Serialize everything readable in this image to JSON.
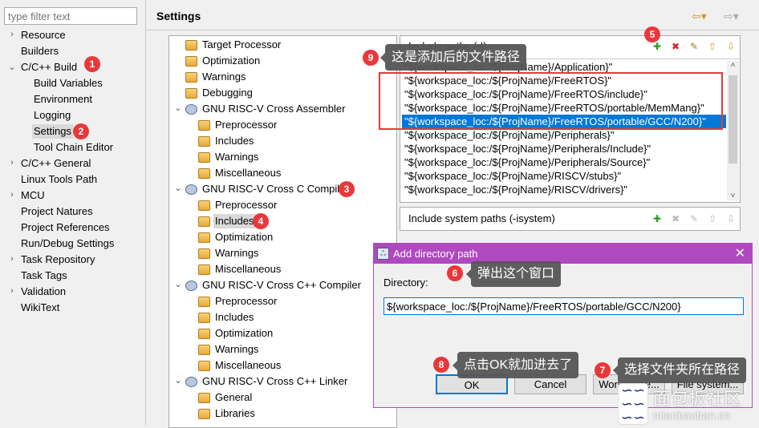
{
  "left": {
    "filter_placeholder": "type filter text",
    "items": [
      {
        "label": "Resource",
        "level": 0,
        "chevron": ">"
      },
      {
        "label": "Builders",
        "level": 0
      },
      {
        "label": "C/C++ Build",
        "level": 0,
        "chevron": "v"
      },
      {
        "label": "Build Variables",
        "level": 1
      },
      {
        "label": "Environment",
        "level": 1
      },
      {
        "label": "Logging",
        "level": 1
      },
      {
        "label": "Settings",
        "level": 1,
        "selected": true
      },
      {
        "label": "Tool Chain Editor",
        "level": 1
      },
      {
        "label": "C/C++ General",
        "level": 0,
        "chevron": ">"
      },
      {
        "label": "Linux Tools Path",
        "level": 0
      },
      {
        "label": "MCU",
        "level": 0,
        "chevron": ">"
      },
      {
        "label": "Project Natures",
        "level": 0
      },
      {
        "label": "Project References",
        "level": 0
      },
      {
        "label": "Run/Debug Settings",
        "level": 0
      },
      {
        "label": "Task Repository",
        "level": 0,
        "chevron": ">"
      },
      {
        "label": "Task Tags",
        "level": 0
      },
      {
        "label": "Validation",
        "level": 0,
        "chevron": ">"
      },
      {
        "label": "WikiText",
        "level": 0
      }
    ]
  },
  "header": {
    "title": "Settings",
    "back_icon": "back-arrow-icon",
    "forward_icon": "forward-arrow-icon"
  },
  "tool_tree": [
    {
      "label": "Target Processor",
      "level": 1,
      "icon": "folder"
    },
    {
      "label": "Optimization",
      "level": 1,
      "icon": "folder"
    },
    {
      "label": "Warnings",
      "level": 1,
      "icon": "folder"
    },
    {
      "label": "Debugging",
      "level": 1,
      "icon": "folder"
    },
    {
      "label": "GNU RISC-V Cross Assembler",
      "level": 0,
      "icon": "tool"
    },
    {
      "label": "Preprocessor",
      "level": 2,
      "icon": "folder"
    },
    {
      "label": "Includes",
      "level": 2,
      "icon": "folder"
    },
    {
      "label": "Warnings",
      "level": 2,
      "icon": "folder"
    },
    {
      "label": "Miscellaneous",
      "level": 2,
      "icon": "folder"
    },
    {
      "label": "GNU RISC-V Cross C Compiler",
      "level": 0,
      "icon": "tool"
    },
    {
      "label": "Preprocessor",
      "level": 2,
      "icon": "folder"
    },
    {
      "label": "Includes",
      "level": 2,
      "icon": "folder",
      "selected": true
    },
    {
      "label": "Optimization",
      "level": 2,
      "icon": "folder"
    },
    {
      "label": "Warnings",
      "level": 2,
      "icon": "folder"
    },
    {
      "label": "Miscellaneous",
      "level": 2,
      "icon": "folder"
    },
    {
      "label": "GNU RISC-V Cross C++ Compiler",
      "level": 0,
      "icon": "tool"
    },
    {
      "label": "Preprocessor",
      "level": 2,
      "icon": "folder"
    },
    {
      "label": "Includes",
      "level": 2,
      "icon": "folder"
    },
    {
      "label": "Optimization",
      "level": 2,
      "icon": "folder"
    },
    {
      "label": "Warnings",
      "level": 2,
      "icon": "folder"
    },
    {
      "label": "Miscellaneous",
      "level": 2,
      "icon": "folder"
    },
    {
      "label": "GNU RISC-V Cross C++ Linker",
      "level": 0,
      "icon": "tool"
    },
    {
      "label": "General",
      "level": 2,
      "icon": "folder"
    },
    {
      "label": "Libraries",
      "level": 2,
      "icon": "folder"
    }
  ],
  "include_paths": {
    "title": "Include paths (-I)",
    "toolbar": [
      "add-icon",
      "delete-icon",
      "edit-icon",
      "move-up-icon",
      "move-down-icon"
    ],
    "items": [
      "\"${workspace_loc:/${ProjName}/Application}\"",
      "\"${workspace_loc:/${ProjName}/FreeRTOS}\"",
      "\"${workspace_loc:/${ProjName}/FreeRTOS/include}\"",
      "\"${workspace_loc:/${ProjName}/FreeRTOS/portable/MemMang}\"",
      "\"${workspace_loc:/${ProjName}/FreeRTOS/portable/GCC/N200}\"",
      "\"${workspace_loc:/${ProjName}/Peripherals}\"",
      "\"${workspace_loc:/${ProjName}/Peripherals/Include}\"",
      "\"${workspace_loc:/${ProjName}/Peripherals/Source}\"",
      "\"${workspace_loc:/${ProjName}/RISCV/stubs}\"",
      "\"${workspace_loc:/${ProjName}/RISCV/drivers}\""
    ],
    "selected_index": 4
  },
  "system_paths": {
    "title": "Include system paths (-isystem)"
  },
  "dialog": {
    "title": "Add directory path",
    "directory_label": "Directory:",
    "directory_value": "${workspace_loc:/${ProjName}/FreeRTOS/portable/GCC/N200}",
    "ok": "OK",
    "cancel": "Cancel",
    "workspace": "Workspace...",
    "file_system": "File system..."
  },
  "annotations": [
    {
      "n": "1"
    },
    {
      "n": "2"
    },
    {
      "n": "3"
    },
    {
      "n": "4"
    },
    {
      "n": "5"
    },
    {
      "n": "6",
      "text": "弹出这个窗口"
    },
    {
      "n": "7",
      "text": "选择文件夹所在路径"
    },
    {
      "n": "8",
      "text": "点击OK就加进去了"
    },
    {
      "n": "9",
      "text": "这是添加后的文件路径"
    }
  ],
  "watermark": {
    "name": "面包板社区",
    "url": "mianbaoban.cn"
  },
  "colors": {
    "selection": "#0078d7",
    "dialog_title": "#b048c0",
    "badge": "#e8383b",
    "highlight_box": "#e8383b"
  }
}
